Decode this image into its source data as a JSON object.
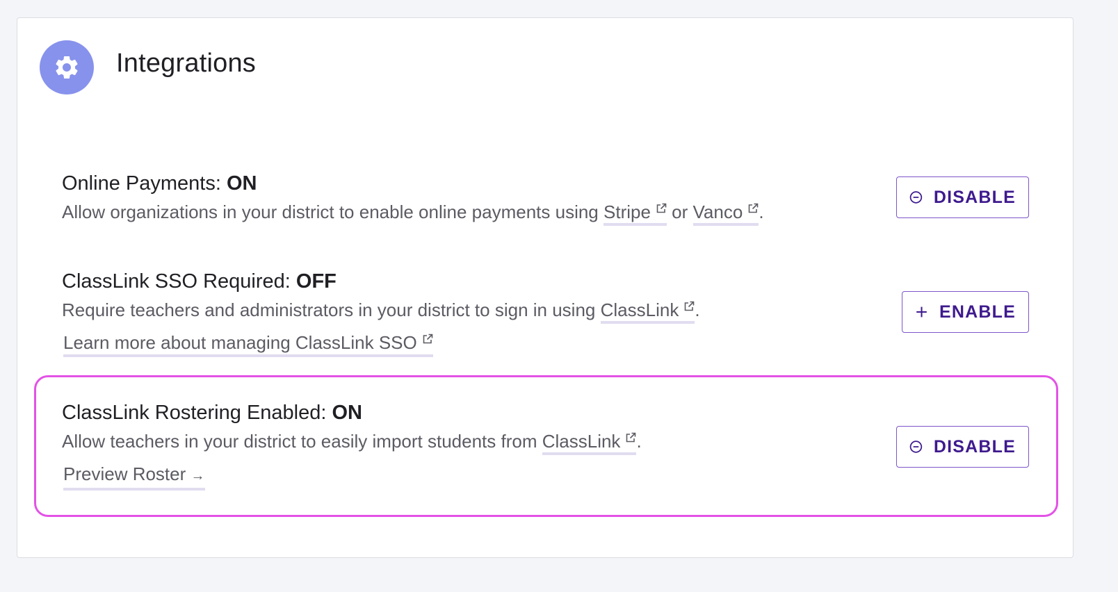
{
  "header": {
    "title": "Integrations",
    "icon": "gear-icon",
    "icon_bg": "#8792ec"
  },
  "rows": [
    {
      "title": "Online Payments:",
      "status": "ON",
      "desc_before": "Allow organizations in your district to enable online payments using",
      "link1": "Stripe",
      "desc_mid": "or",
      "link2": "Vanco",
      "desc_after": ".",
      "button_label": "DISABLE",
      "button_icon": "minus-circle-icon"
    },
    {
      "title": "ClassLink SSO Required:",
      "status": "OFF",
      "desc_before": "Require teachers and administrators in your district to sign in using",
      "link1": "ClassLink",
      "desc_after": ".",
      "sub_link": "Learn more about managing ClassLink SSO",
      "button_label": "ENABLE",
      "button_icon": "plus-icon"
    },
    {
      "title": "ClassLink Rostering Enabled:",
      "status": "ON",
      "desc_before": "Allow teachers in your district to easily import students from",
      "link1": "ClassLink",
      "desc_after": ".",
      "sub_link": "Preview Roster",
      "sub_link_arrow": "→",
      "button_label": "DISABLE",
      "button_icon": "minus-circle-icon"
    }
  ],
  "colors": {
    "accent": "#3e1a8e",
    "button_border": "#7c54c9",
    "highlight": "#e352e6",
    "link_underline": "#e1dcf0"
  }
}
